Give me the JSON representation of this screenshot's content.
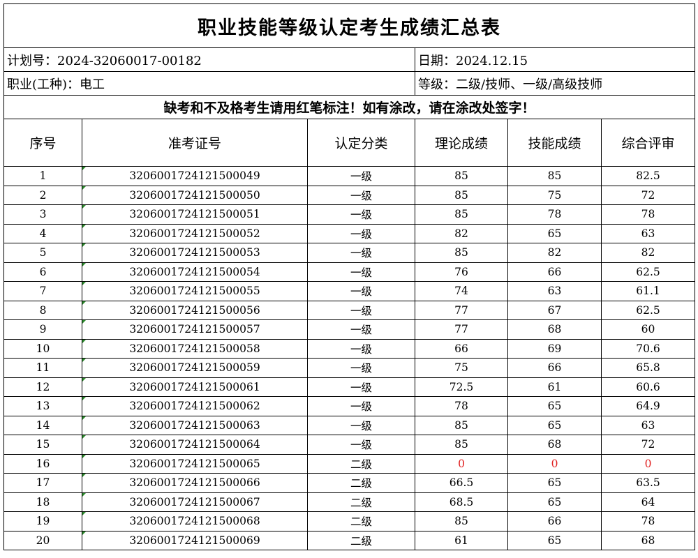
{
  "title": "职业技能等级认定考生成绩汇总表",
  "info": {
    "plan_no": "计划号：2024-32060017-00182",
    "date": "日期：2024.12.15",
    "occupation": "职业(工种)：电工",
    "level": "等级：二级/技师、一级/高级技师"
  },
  "notice": "缺考和不及格考生请用红笔标注！如有涂改，请在涂改处签字！",
  "columns": [
    "序号",
    "准考证号",
    "认定分类",
    "理论成绩",
    "技能成绩",
    "综合评审"
  ],
  "rows": [
    {
      "no": "1",
      "ticket": "3206001724121500049",
      "category": "一级",
      "theory": "85",
      "skill": "85",
      "review": "82.5"
    },
    {
      "no": "2",
      "ticket": "3206001724121500050",
      "category": "一级",
      "theory": "85",
      "skill": "75",
      "review": "72"
    },
    {
      "no": "3",
      "ticket": "3206001724121500051",
      "category": "一级",
      "theory": "85",
      "skill": "78",
      "review": "78"
    },
    {
      "no": "4",
      "ticket": "3206001724121500052",
      "category": "一级",
      "theory": "82",
      "skill": "65",
      "review": "63"
    },
    {
      "no": "5",
      "ticket": "3206001724121500053",
      "category": "一级",
      "theory": "85",
      "skill": "82",
      "review": "82"
    },
    {
      "no": "6",
      "ticket": "3206001724121500054",
      "category": "一级",
      "theory": "76",
      "skill": "66",
      "review": "62.5"
    },
    {
      "no": "7",
      "ticket": "3206001724121500055",
      "category": "一级",
      "theory": "74",
      "skill": "63",
      "review": "61.1"
    },
    {
      "no": "8",
      "ticket": "3206001724121500056",
      "category": "一级",
      "theory": "77",
      "skill": "67",
      "review": "62.5"
    },
    {
      "no": "9",
      "ticket": "3206001724121500057",
      "category": "一级",
      "theory": "77",
      "skill": "68",
      "review": "60"
    },
    {
      "no": "10",
      "ticket": "3206001724121500058",
      "category": "一级",
      "theory": "66",
      "skill": "69",
      "review": "70.6"
    },
    {
      "no": "11",
      "ticket": "3206001724121500059",
      "category": "一级",
      "theory": "75",
      "skill": "66",
      "review": "65.8"
    },
    {
      "no": "12",
      "ticket": "3206001724121500061",
      "category": "一级",
      "theory": "72.5",
      "skill": "61",
      "review": "60.6"
    },
    {
      "no": "13",
      "ticket": "3206001724121500062",
      "category": "一级",
      "theory": "78",
      "skill": "65",
      "review": "64.9"
    },
    {
      "no": "14",
      "ticket": "3206001724121500063",
      "category": "一级",
      "theory": "85",
      "skill": "65",
      "review": "63"
    },
    {
      "no": "15",
      "ticket": "3206001724121500064",
      "category": "一级",
      "theory": "85",
      "skill": "68",
      "review": "72"
    },
    {
      "no": "16",
      "ticket": "3206001724121500065",
      "category": "二级",
      "theory": "0",
      "skill": "0",
      "review": "0",
      "highlight": "#e02020"
    },
    {
      "no": "17",
      "ticket": "3206001724121500066",
      "category": "二级",
      "theory": "66.5",
      "skill": "65",
      "review": "63.5"
    },
    {
      "no": "18",
      "ticket": "3206001724121500067",
      "category": "二级",
      "theory": "68.5",
      "skill": "65",
      "review": "64"
    },
    {
      "no": "19",
      "ticket": "3206001724121500068",
      "category": "二级",
      "theory": "85",
      "skill": "66",
      "review": "78"
    },
    {
      "no": "20",
      "ticket": "3206001724121500069",
      "category": "二级",
      "theory": "61",
      "skill": "65",
      "review": "68"
    }
  ]
}
